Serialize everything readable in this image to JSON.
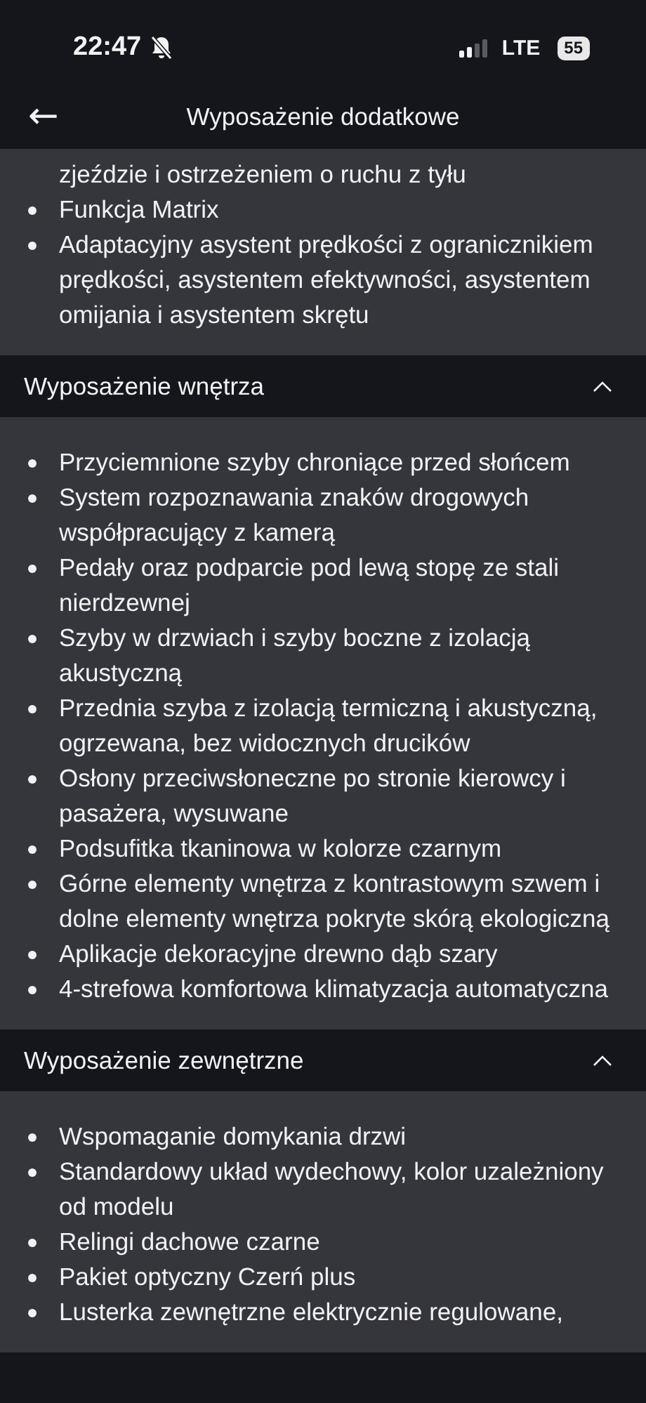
{
  "status_bar": {
    "time": "22:47",
    "muted": true,
    "network": "LTE",
    "battery": "55"
  },
  "header": {
    "back": "←",
    "title": "Wyposażenie dodatkowe"
  },
  "partial_section": {
    "items": [
      {
        "text": "zjeździe i ostrzeżeniem o ruchu z tyłu",
        "continued": true
      },
      {
        "text": "Funkcja Matrix",
        "continued": false
      },
      {
        "text": "Adaptacyjny asystent prędkości z ogranicznikiem prędkości, asystentem efektywności, asystentem omijania i asystentem skrętu",
        "continued": false
      }
    ]
  },
  "sections": [
    {
      "title": "Wyposażenie wnętrza",
      "expanded": true,
      "items": [
        "Przyciemnione szyby chroniące przed słońcem",
        "System rozpoznawania znaków drogowych współpracujący z kamerą",
        "Pedały oraz podparcie pod lewą stopę ze stali nierdzewnej",
        "Szyby w drzwiach i szyby boczne z izolacją akustyczną",
        "Przednia szyba z izolacją termiczną i akustyczną, ogrzewana, bez widocznych drucików",
        "Osłony przeciwsłoneczne po stronie kierowcy i pasażera, wysuwane",
        "Podsufitka tkaninowa w kolorze czarnym",
        "Górne elementy wnętrza z kontrastowym szwem i dolne elementy wnętrza pokryte skórą ekologiczną",
        "Aplikacje dekoracyjne drewno dąb szary",
        "4-strefowa komfortowa klimatyzacja automatyczna"
      ]
    },
    {
      "title": "Wyposażenie zewnętrzne",
      "expanded": true,
      "items": [
        "Wspomaganie domykania drzwi",
        "Standardowy układ wydechowy, kolor uzależniony od modelu",
        "Relingi dachowe czarne",
        "Pakiet optyczny Czerń plus",
        "Lusterka zewnętrzne elektrycznie regulowane,"
      ]
    }
  ]
}
